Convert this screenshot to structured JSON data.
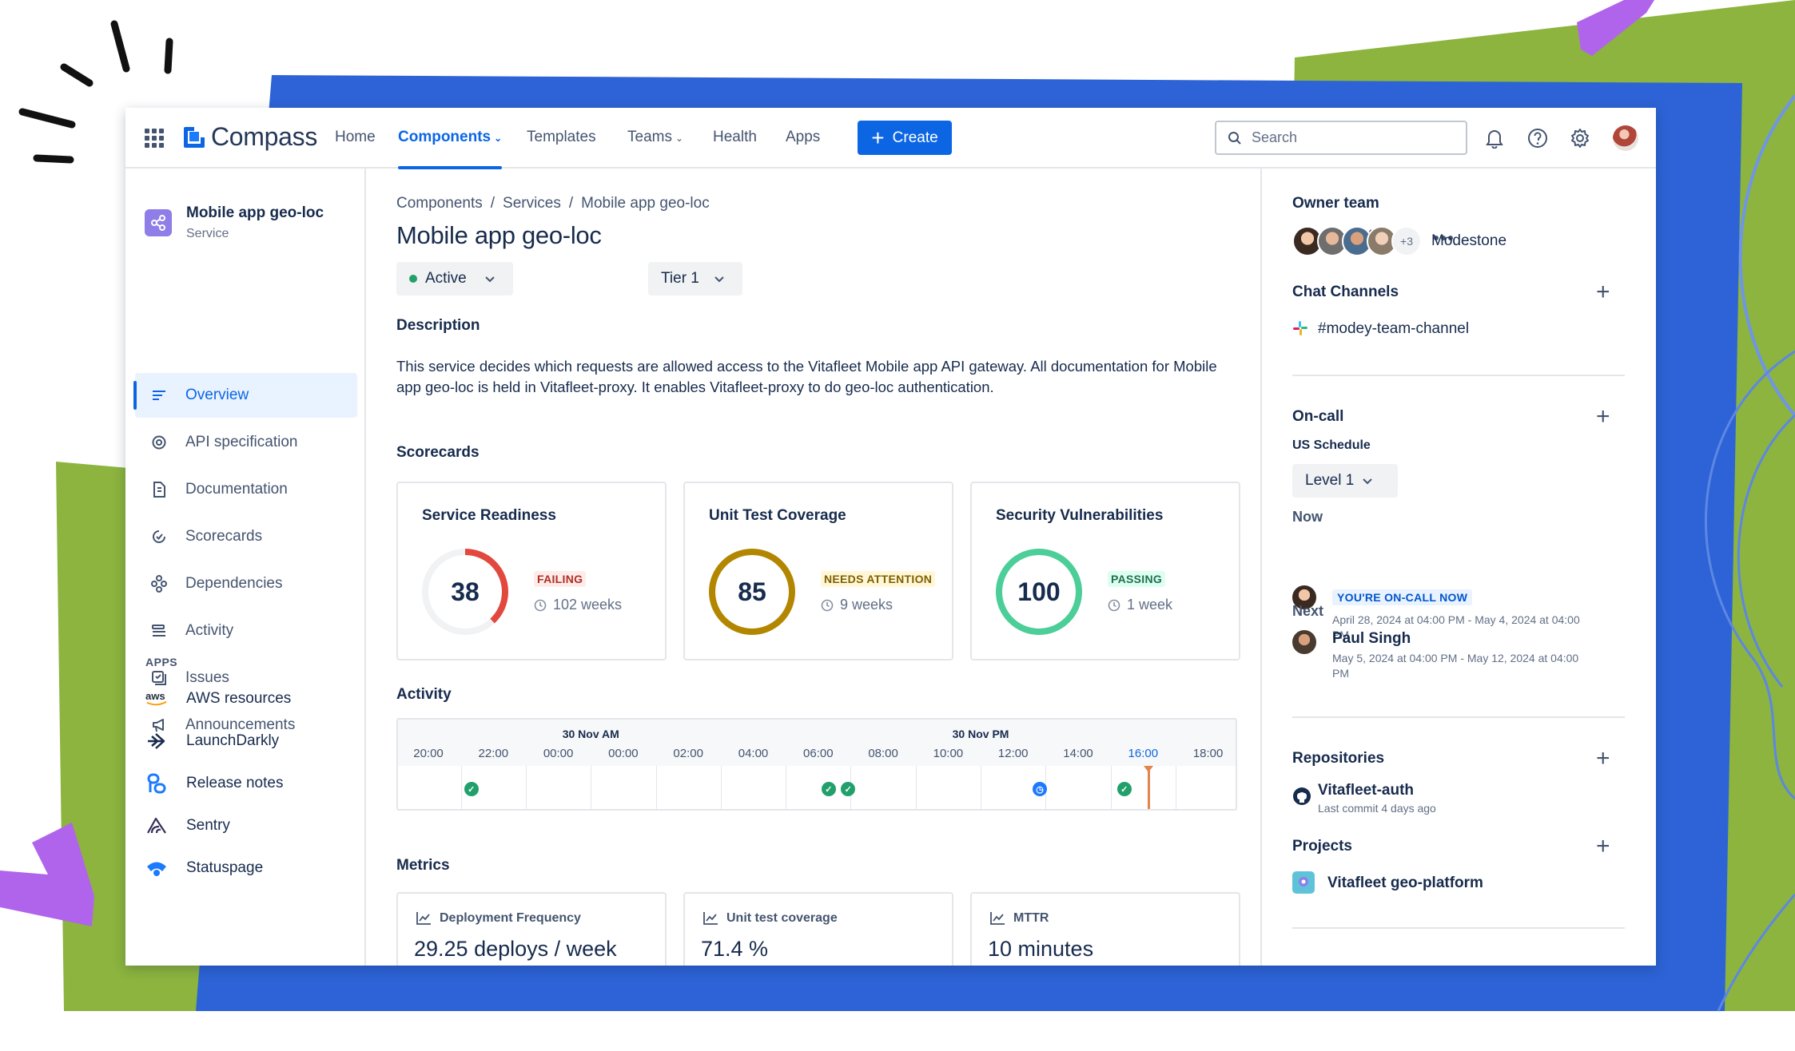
{
  "nav": {
    "logo": "Compass",
    "items": [
      {
        "label": "Home"
      },
      {
        "label": "Components"
      },
      {
        "label": "Templates"
      },
      {
        "label": "Teams"
      },
      {
        "label": "Health"
      },
      {
        "label": "Apps"
      }
    ],
    "create_label": "Create",
    "search_placeholder": "Search"
  },
  "sidebar": {
    "component_name": "Mobile app geo-loc",
    "component_type": "Service",
    "items": [
      {
        "label": "Overview",
        "icon": "overview-icon"
      },
      {
        "label": "API specification",
        "icon": "api-icon"
      },
      {
        "label": "Documentation",
        "icon": "document-icon"
      },
      {
        "label": "Scorecards",
        "icon": "scorecard-icon"
      },
      {
        "label": "Dependencies",
        "icon": "dependencies-icon"
      },
      {
        "label": "Activity",
        "icon": "activity-icon"
      },
      {
        "label": "Issues",
        "icon": "issues-icon"
      },
      {
        "label": "Announcements",
        "icon": "megaphone-icon"
      }
    ],
    "apps_heading": "APPS",
    "apps": [
      {
        "label": "AWS resources",
        "icon": "aws-icon"
      },
      {
        "label": "LaunchDarkly",
        "icon": "launchdarkly-icon"
      },
      {
        "label": "Release notes",
        "icon": "release-notes-icon"
      },
      {
        "label": "Sentry",
        "icon": "sentry-icon"
      },
      {
        "label": "Statuspage",
        "icon": "statuspage-icon"
      }
    ]
  },
  "main": {
    "breadcrumbs": [
      "Components",
      "Services",
      "Mobile app geo-loc"
    ],
    "title": "Mobile app geo-loc",
    "status_label": "Active",
    "tier_label": "Tier 1",
    "description_heading": "Description",
    "description": "This service decides which requests are allowed access to the Vitafleet Mobile app API gateway. All documentation for Mobile app geo-loc is held in Vitafleet-proxy. It enables Vitafleet-proxy to do geo-loc authentication.",
    "scorecards_heading": "Scorecards",
    "scorecards": [
      {
        "title": "Service Readiness",
        "score": "38",
        "score_fraction": 0.38,
        "status": "FAILING",
        "since": "102 weeks",
        "color": "#e2483d",
        "status_bg": "#ffecea",
        "status_fg": "#ae2e24"
      },
      {
        "title": "Unit Test Coverage",
        "score": "85",
        "score_fraction": 1.0,
        "status": "NEEDS ATTENTION",
        "since": "9 weeks",
        "color": "#b38600",
        "status_bg": "#fff7d6",
        "status_fg": "#7f5f01"
      },
      {
        "title": "Security Vulnerabilities",
        "score": "100",
        "score_fraction": 1.0,
        "status": "PASSING",
        "since": "1 week",
        "color": "#4bce97",
        "status_bg": "#dcfff1",
        "status_fg": "#216e4e"
      }
    ],
    "activity_heading": "Activity",
    "timeline": {
      "groups": [
        "30 Nov AM",
        "30 Nov PM"
      ],
      "ticks": [
        "20:00",
        "22:00",
        "00:00",
        "00:00",
        "02:00",
        "04:00",
        "06:00",
        "08:00",
        "10:00",
        "12:00",
        "14:00",
        "16:00",
        "18:00"
      ],
      "current_tick": "16:00"
    },
    "metrics_heading": "Metrics",
    "metrics": [
      {
        "label": "Deployment Frequency",
        "value": "29.25 deploys / week"
      },
      {
        "label": "Unit test coverage",
        "value": "71.4 %"
      },
      {
        "label": "MTTR",
        "value": "10 minutes"
      }
    ]
  },
  "right": {
    "owner_heading": "Owner team",
    "owner_extra": "+3",
    "owner_team": "Modestone",
    "chat_heading": "Chat Channels",
    "chat_channel": "#modey-team-channel",
    "oncall_heading": "On-call",
    "schedule": "US Schedule",
    "level": "Level 1",
    "now_label": "Now",
    "oncall_badge": "YOU'RE ON-CALL NOW",
    "now_range": "April 28, 2024 at 04:00 PM - May 4, 2024 at 04:00 PM",
    "next_label": "Next",
    "next_person": "Paul Singh",
    "next_range": "May 5, 2024 at 04:00 PM - May 12, 2024 at 04:00 PM",
    "repos_heading": "Repositories",
    "repo_name": "Vitafleet-auth",
    "repo_commit": "Last commit 4 days ago",
    "projects_heading": "Projects",
    "project_name": "Vitafleet geo-platform"
  }
}
